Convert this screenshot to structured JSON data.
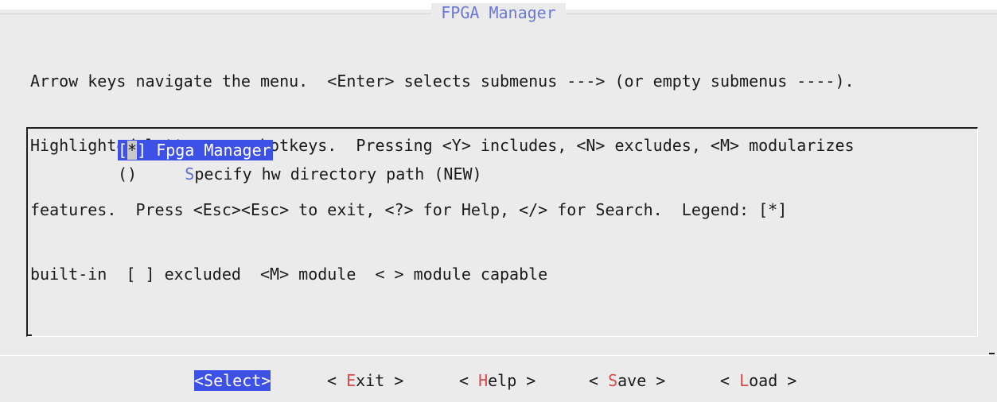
{
  "dialog": {
    "title": "FPGA Manager",
    "help_lines": [
      "Arrow keys navigate the menu.  <Enter> selects submenus ---> (or empty submenus ----).",
      "Highlighted letters are hotkeys.  Pressing <Y> includes, <N> excludes, <M> modularizes",
      "features.  Press <Esc><Esc> to exit, <?> for Help, </> for Search.  Legend: [*]",
      "built-in  [ ] excluded  <M> module  < > module capable"
    ]
  },
  "menu": {
    "items": [
      {
        "open": "[",
        "mark": "*",
        "close": "] ",
        "label": "Fpga Manager",
        "selected": true
      },
      {
        "prefix": "()     ",
        "hotkey": "S",
        "rest": "pecify hw directory path (NEW)",
        "selected": false
      }
    ]
  },
  "buttons": [
    {
      "full": "<Select>",
      "active": true
    },
    {
      "pre": "< ",
      "key": "E",
      "post": "xit >"
    },
    {
      "pre": "< ",
      "key": "H",
      "post": "elp >"
    },
    {
      "pre": "< ",
      "key": "S",
      "post": "ave >"
    },
    {
      "pre": "< ",
      "key": "L",
      "post": "oad >"
    }
  ],
  "colors": {
    "highlight": "#3e51e6",
    "hotkey": "#d94a4a",
    "title": "#6b78d6",
    "background": "#ebebeb"
  }
}
